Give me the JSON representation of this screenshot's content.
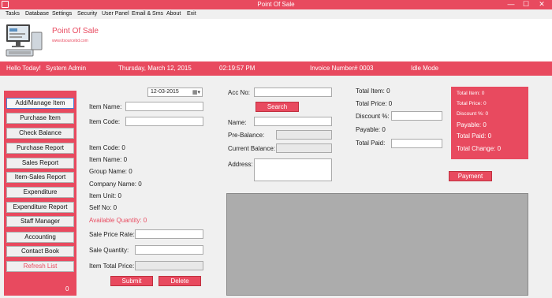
{
  "window": {
    "title": "Point Of Sale",
    "min": "—",
    "max": "☐",
    "close": "✕"
  },
  "menu": [
    "Tasks",
    "Database",
    "Settings",
    "Security",
    "User Panel",
    "Email & Sms",
    "About",
    "Exit"
  ],
  "banner": {
    "name": "Point Of Sale",
    "url": "www.itsourcebd.com",
    "logo_icon": "monitor-pos-icon"
  },
  "status": {
    "greeting": "Hello Today!",
    "user": "System Admin",
    "date": "Thursday, March 12, 2015",
    "time": "02:19:57 PM",
    "invoice": "Invoice Number# 0003",
    "mode": "Idle Mode"
  },
  "sidebar": {
    "items": [
      "Add/Manage Item",
      "Purchase Item",
      "Check Balance",
      "Purchase Report",
      "Sales Report",
      "Item-Sales Report",
      "Expenditure",
      "Expenditure Report",
      "Staff Manager",
      "Accounting",
      "Contact Book",
      "Refresh List"
    ],
    "count": "0"
  },
  "item": {
    "date": "12-03-2015",
    "name_label": "Item Name:",
    "code_label": "Item Code:",
    "info_code": "Item Code:  0",
    "info_name": "Item Name:  0",
    "info_group": "Group Name:  0",
    "info_company": "Company Name:  0",
    "info_unit": "Item Unit:  0",
    "info_self": "Self No:  0",
    "available": "Available Quantity:  0",
    "sale_price_label": "Sale Price Rate:",
    "sale_qty_label": "Sale Quantity:",
    "total_price_label": "Item Total Price:",
    "submit": "Submit",
    "delete": "Delete"
  },
  "customer": {
    "acc_label": "Acc No:",
    "search": "Search",
    "name_label": "Name:",
    "pre_balance_label": "Pre-Balance:",
    "current_balance_label": "Current Balance:",
    "address_label": "Address:"
  },
  "totals": {
    "total_item": "Total Item:  0",
    "total_price": "Total Price:  0",
    "discount_label": "Discount %:",
    "payable": "Payable:  0",
    "total_paid_label": "Total Paid:",
    "payment": "Payment"
  },
  "summary": {
    "total_item": "Total Item:  0",
    "total_price": "Total Price:  0",
    "discount": "Discount %:  0",
    "payable": "Payable:  0",
    "total_paid": "Total Paid:  0",
    "total_change": "Total Change:  0"
  },
  "colors": {
    "accent": "#e84a5f",
    "grid": "#acacac"
  }
}
